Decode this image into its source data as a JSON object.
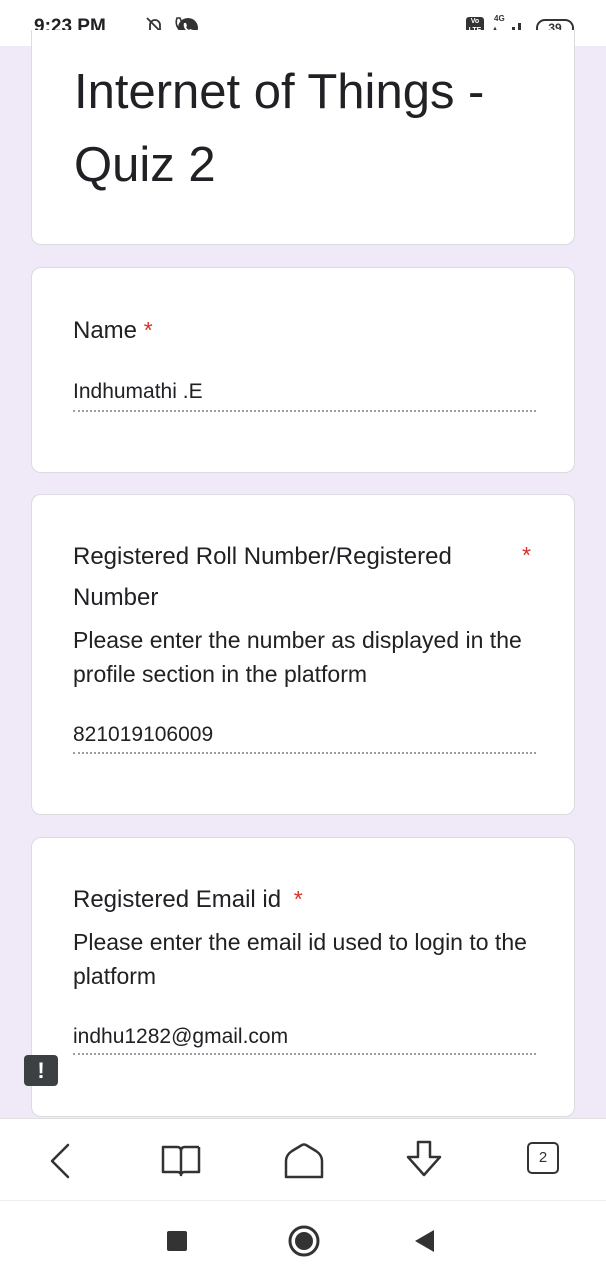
{
  "status_bar": {
    "time": "9:23 PM",
    "network": "4G",
    "volte": "Vo LTE",
    "battery": "39",
    "icons": [
      "muted-bell-icon",
      "phone-call-icon",
      "whatsapp-call-icon",
      "volte-icon",
      "signal-icon",
      "battery-icon"
    ]
  },
  "form": {
    "title": "Internet of Things - Quiz 2",
    "required_marker": "*",
    "questions": [
      {
        "label": "Name",
        "answer": "Indhumathi .E"
      },
      {
        "label": "Registered Roll Number/Registered Number",
        "description": "Please enter the number as displayed in the profile section in the platform",
        "answer": "821019106009"
      },
      {
        "label": "Registered Email id",
        "description": "Please enter the email id used to login to the platform",
        "answer": "indhu1282@gmail.com"
      }
    ]
  },
  "browser_toolbar": {
    "tab_count": "2",
    "icons": [
      "back-icon",
      "bookmarks-icon",
      "home-icon",
      "download-icon",
      "tabs-icon"
    ]
  },
  "system_nav": {
    "icons": [
      "recents-icon",
      "home-circle-icon",
      "back-triangle-icon"
    ]
  },
  "colors": {
    "background": "#efe9f8",
    "required": "#d93025",
    "card": "#ffffff"
  }
}
